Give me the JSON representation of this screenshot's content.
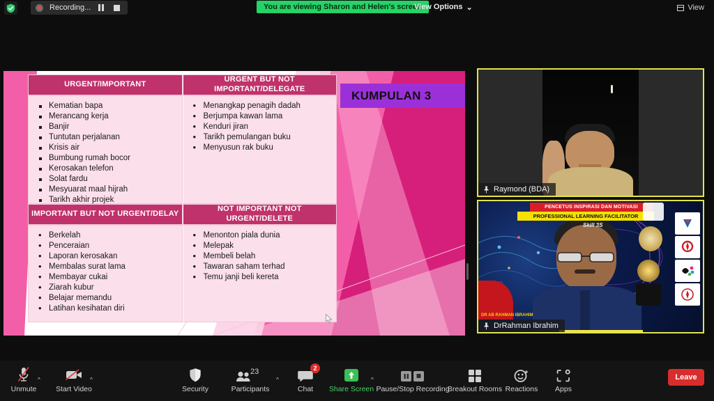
{
  "topbar": {
    "recording_label": "Recording...",
    "pause_icon": "pause-icon",
    "stop_icon": "stop-icon",
    "shield_icon": "security-shield-icon",
    "viewing_banner": "You are viewing Sharon and Helen's screen",
    "view_options_label": "View Options",
    "view_options_caret": "⌄",
    "view_label": "View"
  },
  "slide": {
    "group_title": "KUMPULAN 3",
    "quadrants": [
      {
        "header": "URGENT/IMPORTANT",
        "bullet": "square",
        "items": [
          "Kematian bapa",
          "Merancang kerja",
          "Banjir",
          "Tuntutan perjalanan",
          "Krisis air",
          "Bumbung rumah bocor",
          "Kerosakan telefon",
          "Solat fardu",
          "Mesyuarat maal hijrah",
          "Tarikh akhir projek"
        ]
      },
      {
        "header": "URGENT BUT NOT IMPORTANT/DELEGATE",
        "bullet": "dot",
        "items": [
          "Menangkap penagih dadah",
          "Berjumpa kawan lama",
          "Kenduri jiran",
          "Tarikh pemulangan buku",
          "Menyusun rak buku"
        ]
      },
      {
        "header": "IMPORTANT BUT NOT URGENT/DELAY",
        "bullet": "dot",
        "items": [
          "Berkelah",
          "Penceraian",
          "Laporan kerosakan",
          "Membalas surat lama",
          "Membayar cukai",
          "Ziarah kubur",
          "Belajar memandu",
          "Latihan kesihatan diri"
        ]
      },
      {
        "header": "NOT IMPORTANT NOT URGENT/DELETE",
        "bullet": "dot",
        "items": [
          "Menonton piala dunia",
          "Melepak",
          "Membeli belah",
          "Tawaran saham terhad",
          "Temu janji beli kereta"
        ]
      }
    ],
    "colors": {
      "header_bg": "#c0326b",
      "cell_bg": "#fbdfea",
      "banner_bg": "#9b30d9",
      "accent_pink": "#f25fa8",
      "accent_magenta": "#d61f7a"
    }
  },
  "videos": [
    {
      "name": "Raymond (BDA)",
      "pin_icon": "pin-icon",
      "active_speaker": true
    },
    {
      "name": "DrRahman Ibrahim",
      "pin_icon": "pin-icon",
      "active_speaker": true,
      "overlay_red": "PENCETUS INSPIRASI DAN MOTIVASI",
      "overlay_yellow": "PROFESSIONAL LEARNING FACILITATOR",
      "overlay_skill": "Skill 3S",
      "overlay_nametag": "DR AB RAHMAN IBRAHIM"
    }
  ],
  "toolbar": {
    "items": [
      {
        "label": "Unmute",
        "icon": "microphone-muted-icon",
        "caret": "^"
      },
      {
        "label": "Start Video",
        "icon": "video-off-icon",
        "caret": "^"
      },
      {
        "label": "Security",
        "icon": "shield-icon"
      },
      {
        "label": "Participants",
        "icon": "participants-icon",
        "count": "23",
        "caret": "^"
      },
      {
        "label": "Chat",
        "icon": "chat-icon",
        "badge": "2"
      },
      {
        "label": "Share Screen",
        "icon": "share-screen-icon",
        "caret": "^"
      },
      {
        "label": "Pause/Stop Recording",
        "icon": "pause-stop-recording-icon"
      },
      {
        "label": "Breakout Rooms",
        "icon": "breakout-rooms-icon"
      },
      {
        "label": "Reactions",
        "icon": "reactions-icon"
      },
      {
        "label": "Apps",
        "icon": "apps-icon"
      }
    ],
    "leave_label": "Leave",
    "colors": {
      "share_green": "#4ad168",
      "leave_red": "#d92d2d",
      "badge_red": "#e02b2b"
    }
  }
}
